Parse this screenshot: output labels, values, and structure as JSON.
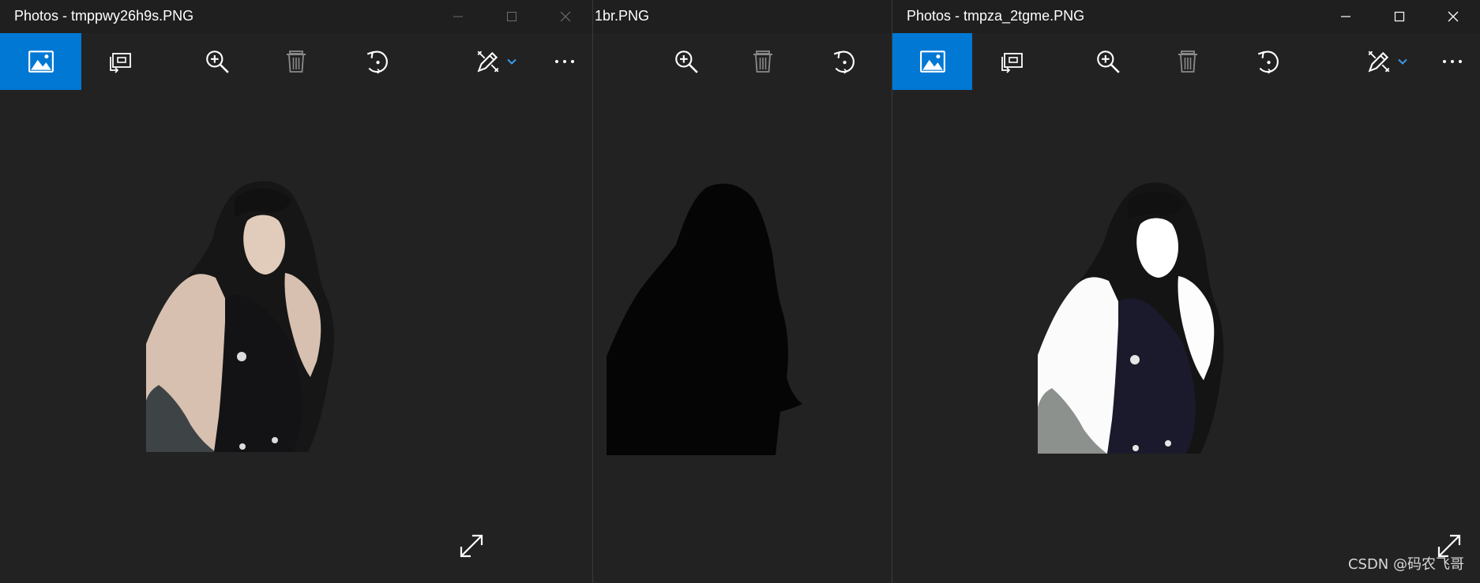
{
  "windows": {
    "left": {
      "title": "Photos - tmppwy26h9s.PNG"
    },
    "middle": {
      "title": "1br.PNG"
    },
    "right": {
      "title": "Photos - tmpza_2tgme.PNG"
    }
  },
  "toolbar_icons": [
    "image-icon",
    "slideshow-icon",
    "zoom-in-icon",
    "delete-icon",
    "rotate-icon",
    "edit-create-icon",
    "chevron-down-icon",
    "more-icon"
  ],
  "colors": {
    "accent": "#0078d4",
    "window_bg": "#222222",
    "titlebar_bg": "#1f1f1f",
    "icon": "#ffffff",
    "icon_disabled": "#8a8a8a"
  },
  "watermark": "CSDN @码农飞哥"
}
